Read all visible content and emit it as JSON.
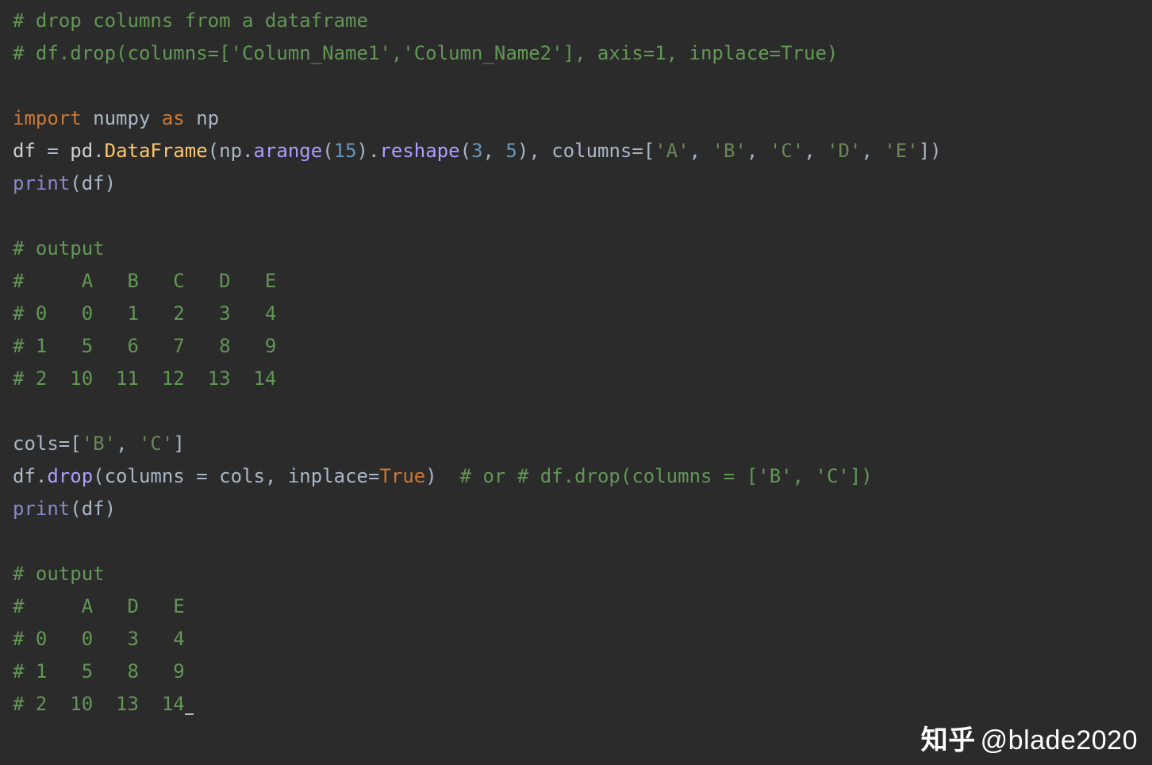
{
  "code": {
    "line1_comment": "# drop columns from a dataframe",
    "line2_comment": "# df.drop(columns=['Column_Name1','Column_Name2'], axis=1, inplace=True)",
    "blank1": "",
    "import_kw": "import",
    "import_mod": "numpy",
    "as_kw": "as",
    "import_alias": "np",
    "df_assign_lhs": "df",
    "equals": " = ",
    "pd": "pd",
    "dot1": ".",
    "DataFrame": "DataFrame",
    "lpar1": "(",
    "np": "np",
    "dot2": ".",
    "arange": "arange",
    "lpar2": "(",
    "num15": "15",
    "rpar2": ")",
    "dot3": ".",
    "reshape": "reshape",
    "lpar3": "(",
    "num3": "3",
    "comma1": ", ",
    "num5": "5",
    "rpar3": ")",
    "comma2": ", ",
    "columns_kw": "columns",
    "eq1": "=[",
    "strA": "'A'",
    "c2": ", ",
    "strB": "'B'",
    "c3": ", ",
    "strC": "'C'",
    "c4": ", ",
    "strD": "'D'",
    "c5": ", ",
    "strE": "'E'",
    "rbr": "])",
    "print1": "print",
    "print1_arg_open": "(",
    "print1_arg": "df",
    "print1_arg_close": ")",
    "blank2": "",
    "out1_header": "# output",
    "out1_row0": "#     A   B   C   D   E",
    "out1_row1": "# 0   0   1   2   3   4",
    "out1_row2": "# 1   5   6   7   8   9",
    "out1_row3": "# 2  10  11  12  13  14",
    "blank3": "",
    "cols_lhs": "cols",
    "cols_eq": "=[",
    "cols_b": "'B'",
    "cols_comma": ", ",
    "cols_c": "'C'",
    "cols_close": "]",
    "drop_obj": "df",
    "drop_dot": ".",
    "drop_fn": "drop",
    "drop_open": "(",
    "drop_p1": "columns",
    "drop_p1eq": " = ",
    "drop_p1v": "cols",
    "drop_comma": ", ",
    "drop_p2": "inplace",
    "drop_p2eq": "=",
    "drop_p2v": "True",
    "drop_close": ")",
    "drop_tail_comment": "  # or # df.drop(columns = ['B', 'C'])",
    "print2": "print",
    "print2_open": "(",
    "print2_arg": "df",
    "print2_close": ")",
    "blank4": "",
    "out2_header": "# output",
    "out2_row0": "#     A   D   E",
    "out2_row1": "# 0   0   3   4",
    "out2_row2": "# 1   5   8   9",
    "out2_row3": "# 2  10  13  14"
  },
  "watermark": {
    "zh": "知乎",
    "at": "@blade2020"
  }
}
